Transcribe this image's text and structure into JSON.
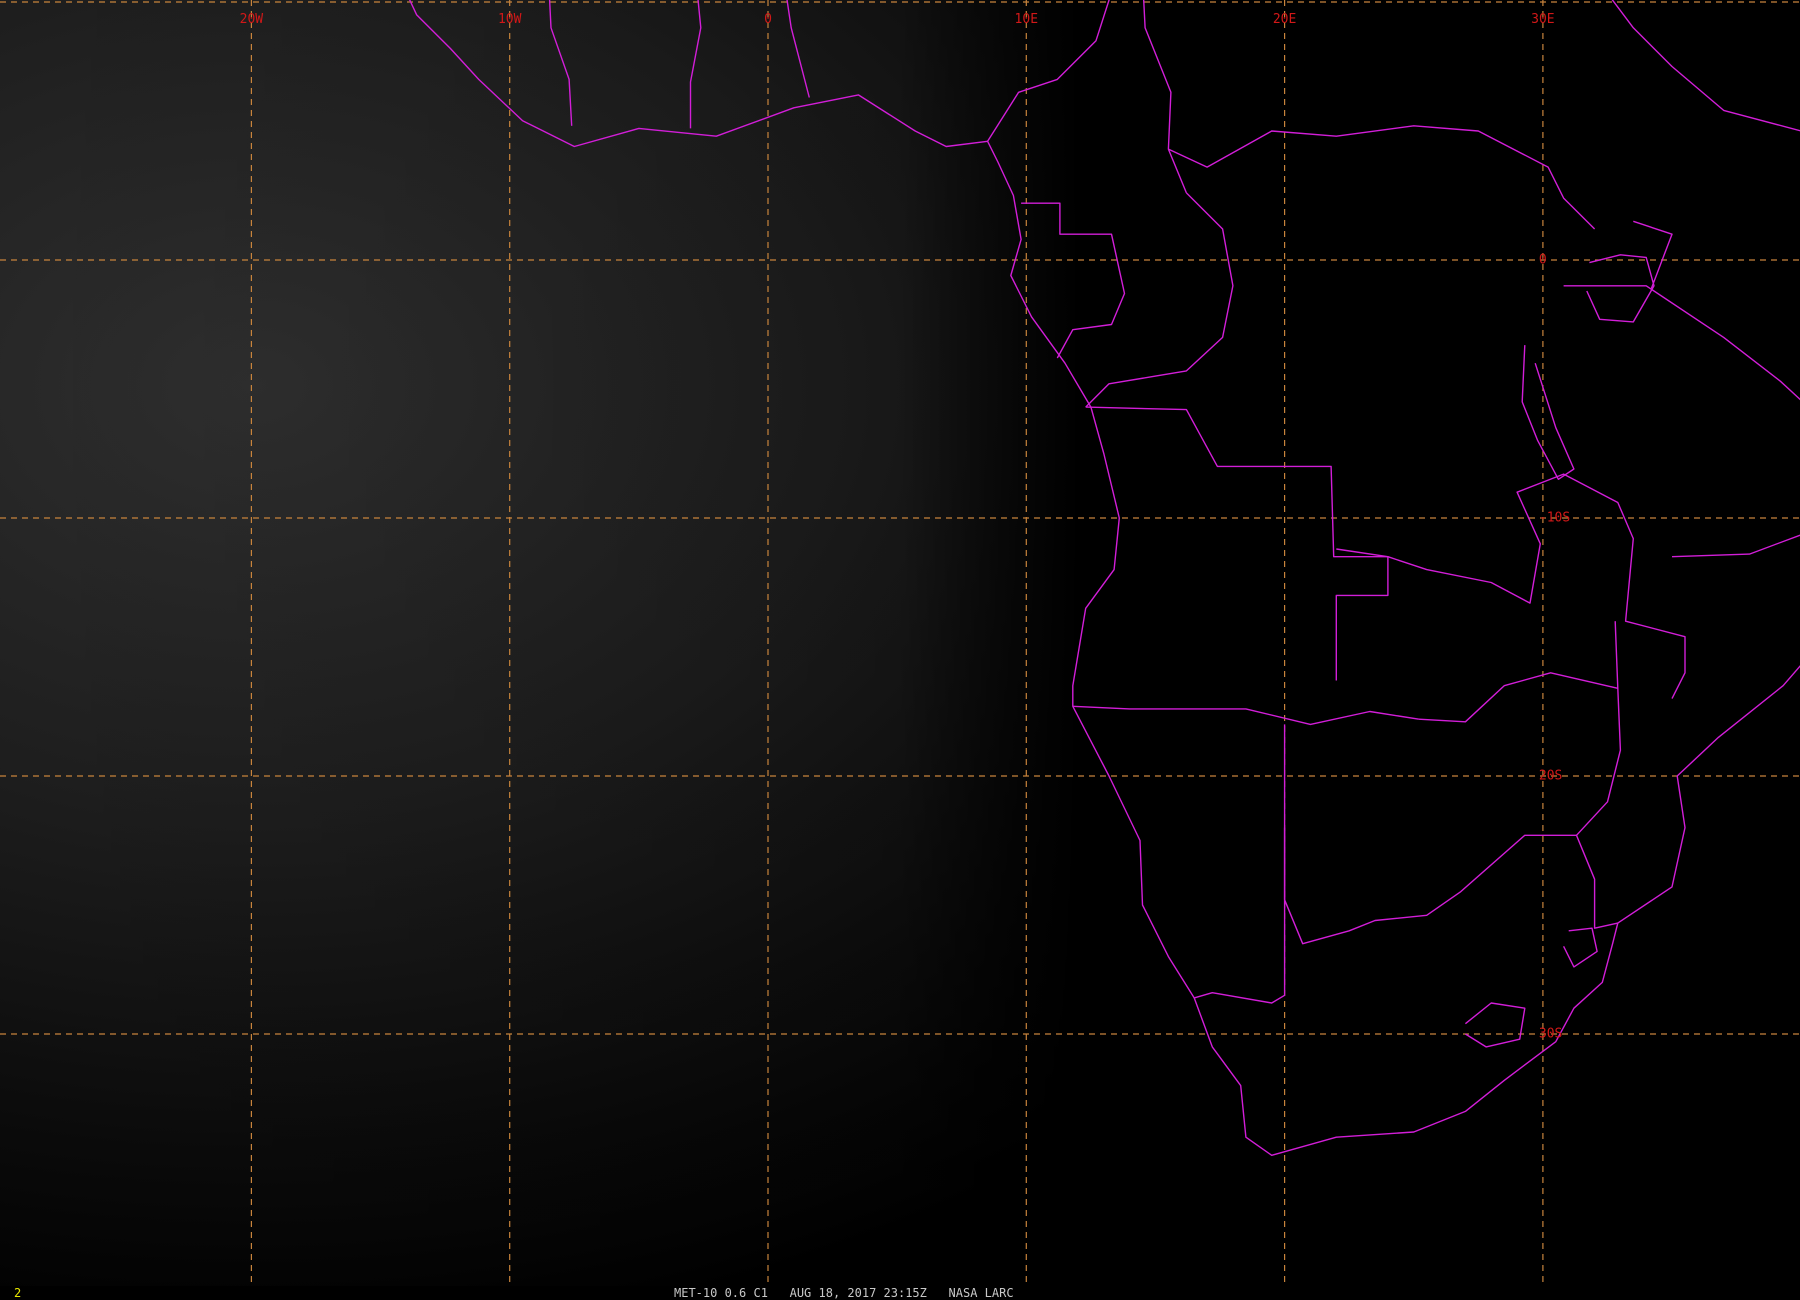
{
  "colors": {
    "background": "#000000",
    "coastline": "#d21ed8",
    "grid": "#c8843c",
    "grid_label": "#d21818",
    "frame_number": "#e8e800",
    "caption": "#c8c8c8"
  },
  "grid": {
    "longitudes": [
      {
        "value": -20,
        "label": "20W"
      },
      {
        "value": -10,
        "label": "10W"
      },
      {
        "value": 0,
        "label": "0"
      },
      {
        "value": 10,
        "label": "10E"
      },
      {
        "value": 20,
        "label": "20E"
      },
      {
        "value": 30,
        "label": "30E"
      }
    ],
    "latitudes": [
      {
        "value": 0,
        "label": "0"
      },
      {
        "value": -10,
        "label": "-10S"
      },
      {
        "value": -20,
        "label": "20S"
      },
      {
        "value": -30,
        "label": "30S"
      }
    ]
  },
  "status": {
    "frame_number": "2",
    "caption": "MET-10 0.6 C1   AUG 18, 2017 23:15Z   NASA LARC"
  },
  "boundaries": [
    {
      "name": "west-africa-coast",
      "points": [
        [
          -14.3,
          11
        ],
        [
          -13.6,
          9.5
        ],
        [
          -12.3,
          8.2
        ],
        [
          -11.2,
          7
        ],
        [
          -9.5,
          5.4
        ],
        [
          -7.5,
          4.4
        ],
        [
          -5,
          5.1
        ],
        [
          -2,
          4.8
        ],
        [
          1,
          5.9
        ],
        [
          3.5,
          6.4
        ],
        [
          5.7,
          5
        ],
        [
          6.9,
          4.4
        ],
        [
          8.5,
          4.6
        ],
        [
          8.9,
          3.8
        ],
        [
          9.5,
          2.5
        ],
        [
          9.8,
          0.8
        ],
        [
          9.4,
          -0.6
        ],
        [
          10.2,
          -2.2
        ],
        [
          11.5,
          -4
        ],
        [
          12.5,
          -5.7
        ],
        [
          13,
          -7.5
        ],
        [
          13.6,
          -10
        ],
        [
          13.4,
          -12
        ],
        [
          12.3,
          -13.5
        ],
        [
          11.8,
          -16.5
        ],
        [
          11.8,
          -17.3
        ],
        [
          13.2,
          -20
        ],
        [
          14.4,
          -22.5
        ],
        [
          14.5,
          -25
        ],
        [
          15.5,
          -27
        ],
        [
          16.5,
          -28.6
        ],
        [
          17.2,
          -30.5
        ],
        [
          18.3,
          -32
        ],
        [
          18.5,
          -34
        ],
        [
          19.5,
          -34.7
        ],
        [
          22,
          -34
        ],
        [
          25,
          -33.8
        ],
        [
          27,
          -33
        ],
        [
          28.5,
          -31.8
        ],
        [
          30.5,
          -30.3
        ],
        [
          31.2,
          -29
        ],
        [
          32.3,
          -28
        ],
        [
          32.7,
          -26.5
        ],
        [
          32.9,
          -25.7
        ],
        [
          35,
          -24.3
        ],
        [
          35.5,
          -22
        ],
        [
          35.2,
          -20
        ],
        [
          36.8,
          -18.5
        ],
        [
          39.3,
          -16.5
        ],
        [
          40.6,
          -15
        ]
      ]
    },
    {
      "name": "gulf-of-guinea-boundaries",
      "points": [
        [
          -8.5,
          11
        ],
        [
          -8.4,
          9
        ],
        [
          -7.7,
          7
        ],
        [
          -7.6,
          5.2
        ]
      ]
    },
    {
      "name": "ghana-boundary",
      "points": [
        [
          -2.8,
          11
        ],
        [
          -2.6,
          9
        ],
        [
          -3,
          6.9
        ],
        [
          -3,
          5.1
        ]
      ]
    },
    {
      "name": "togo-benin-boundary",
      "points": [
        [
          0.6,
          11
        ],
        [
          0.9,
          9
        ],
        [
          1.6,
          6.3
        ]
      ]
    },
    {
      "name": "nigeria-cameroon",
      "points": [
        [
          8.5,
          4.6
        ],
        [
          9.7,
          6.5
        ],
        [
          11.2,
          7
        ],
        [
          12.7,
          8.5
        ],
        [
          13.5,
          11
        ],
        [
          14.5,
          11
        ],
        [
          14.6,
          9
        ],
        [
          15.6,
          6.5
        ],
        [
          15.5,
          4.3
        ],
        [
          16.2,
          2.6
        ]
      ]
    },
    {
      "name": "central-african-boundary",
      "points": [
        [
          15.5,
          4.3
        ],
        [
          17,
          3.6
        ],
        [
          19.5,
          5
        ],
        [
          22,
          4.8
        ],
        [
          25,
          5.2
        ],
        [
          27.5,
          5
        ],
        [
          30.2,
          3.6
        ],
        [
          30.8,
          2.4
        ],
        [
          32,
          1.2
        ]
      ]
    },
    {
      "name": "congo-drc-river",
      "points": [
        [
          16.2,
          2.6
        ],
        [
          17.6,
          1.2
        ],
        [
          18,
          -1
        ],
        [
          17.6,
          -3
        ],
        [
          16.2,
          -4.3
        ],
        [
          15,
          -4.5
        ],
        [
          13.2,
          -4.8
        ],
        [
          12.3,
          -5.7
        ]
      ]
    },
    {
      "name": "gabon-congo",
      "points": [
        [
          9.8,
          2.2
        ],
        [
          11.3,
          2.2
        ],
        [
          11.3,
          1
        ],
        [
          13.3,
          1
        ],
        [
          13.8,
          -1.3
        ],
        [
          13.3,
          -2.5
        ],
        [
          11.8,
          -2.7
        ],
        [
          11.2,
          -3.8
        ]
      ]
    },
    {
      "name": "angola-north",
      "points": [
        [
          12.3,
          -5.7
        ],
        [
          16.2,
          -5.8
        ],
        [
          17.4,
          -8
        ],
        [
          20,
          -8
        ],
        [
          21.8,
          -8
        ],
        [
          21.9,
          -11.5
        ],
        [
          24,
          -11.5
        ],
        [
          24,
          -13
        ],
        [
          22,
          -13
        ],
        [
          22,
          -16.3
        ]
      ]
    },
    {
      "name": "angola-namibia",
      "points": [
        [
          11.8,
          -17.3
        ],
        [
          14,
          -17.4
        ],
        [
          18.5,
          -17.4
        ],
        [
          21,
          -18
        ],
        [
          23.3,
          -17.5
        ],
        [
          25.2,
          -17.8
        ]
      ]
    },
    {
      "name": "botswana-west",
      "points": [
        [
          20,
          -18
        ],
        [
          20,
          -22
        ],
        [
          20,
          -24.8
        ]
      ]
    },
    {
      "name": "namibia-south-africa",
      "points": [
        [
          20,
          -22
        ],
        [
          20,
          -28.5
        ],
        [
          19.5,
          -28.8
        ],
        [
          17.2,
          -28.4
        ],
        [
          16.5,
          -28.6
        ]
      ]
    },
    {
      "name": "botswana-south",
      "points": [
        [
          20,
          -24.8
        ],
        [
          20.7,
          -26.5
        ],
        [
          22.5,
          -26
        ],
        [
          23.5,
          -25.6
        ],
        [
          25.5,
          -25.4
        ],
        [
          26.8,
          -24.5
        ],
        [
          29.3,
          -22.3
        ],
        [
          31.3,
          -22.3
        ]
      ]
    },
    {
      "name": "zambia-zimbabwe",
      "points": [
        [
          25.2,
          -17.8
        ],
        [
          27,
          -17.9
        ],
        [
          28.5,
          -16.5
        ],
        [
          30.3,
          -16
        ],
        [
          32.9,
          -16.6
        ],
        [
          32.8,
          -14
        ]
      ]
    },
    {
      "name": "zimbabwe-mozambique",
      "points": [
        [
          32.9,
          -16.6
        ],
        [
          33,
          -19
        ],
        [
          32.5,
          -21
        ],
        [
          31.3,
          -22.3
        ],
        [
          32,
          -24
        ],
        [
          32,
          -25.9
        ],
        [
          32.9,
          -25.7
        ]
      ]
    },
    {
      "name": "zambia-drc",
      "points": [
        [
          22,
          -11.2
        ],
        [
          24,
          -11.5
        ],
        [
          25.5,
          -12
        ],
        [
          28,
          -12.5
        ],
        [
          29.5,
          -13.3
        ],
        [
          29.9,
          -11
        ],
        [
          29,
          -9
        ],
        [
          30.8,
          -8.3
        ],
        [
          32.9,
          -9.4
        ],
        [
          33.5,
          -10.8
        ],
        [
          33.2,
          -14
        ],
        [
          35.5,
          -14.6
        ],
        [
          35.5,
          -16
        ],
        [
          35,
          -17
        ]
      ]
    },
    {
      "name": "tanzania-east",
      "points": [
        [
          30.8,
          -1
        ],
        [
          34,
          -1
        ],
        [
          37,
          -3
        ],
        [
          39.2,
          -4.7
        ],
        [
          40.6,
          -6
        ],
        [
          40.4,
          -10.5
        ],
        [
          38,
          -11.4
        ],
        [
          35,
          -11.5
        ]
      ]
    },
    {
      "name": "lake-tanganyika",
      "points": [
        [
          29.3,
          -3.3
        ],
        [
          29.2,
          -5.5
        ],
        [
          29.8,
          -7
        ],
        [
          30.6,
          -8.5
        ],
        [
          31.2,
          -8.1
        ],
        [
          30.5,
          -6.5
        ],
        [
          29.7,
          -4
        ]
      ]
    },
    {
      "name": "lake-victoria",
      "points": [
        [
          31.8,
          -0.1
        ],
        [
          33,
          0.2
        ],
        [
          34,
          0.1
        ],
        [
          34.3,
          -1
        ],
        [
          33.5,
          -2.4
        ],
        [
          32.2,
          -2.3
        ],
        [
          31.7,
          -1.2
        ]
      ]
    },
    {
      "name": "lesotho",
      "points": [
        [
          27,
          -29.6
        ],
        [
          28,
          -28.8
        ],
        [
          29.3,
          -29
        ],
        [
          29.1,
          -30.2
        ],
        [
          27.8,
          -30.5
        ],
        [
          27,
          -30
        ]
      ]
    },
    {
      "name": "swaziland",
      "points": [
        [
          31,
          -26
        ],
        [
          31.9,
          -25.9
        ],
        [
          32.1,
          -26.8
        ],
        [
          31.2,
          -27.4
        ],
        [
          30.8,
          -26.6
        ]
      ]
    },
    {
      "name": "east-horn",
      "points": [
        [
          32,
          11
        ],
        [
          33.5,
          9
        ],
        [
          35,
          7.5
        ],
        [
          37,
          5.8
        ],
        [
          40,
          5
        ],
        [
          40.6,
          4.3
        ]
      ]
    },
    {
      "name": "uganda-kenya",
      "points": [
        [
          33.5,
          1.5
        ],
        [
          35,
          1
        ],
        [
          34.2,
          -1.1
        ]
      ]
    }
  ]
}
